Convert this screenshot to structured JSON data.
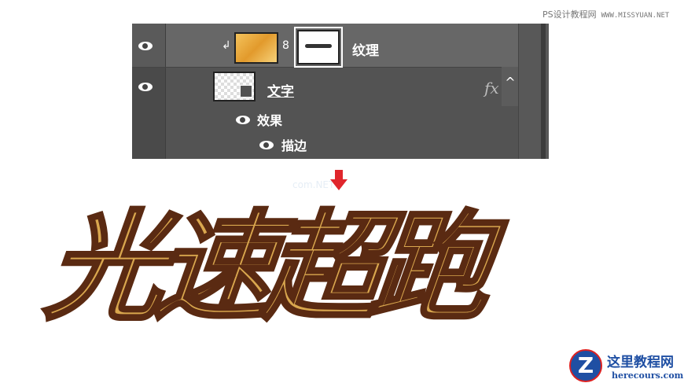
{
  "watermark": {
    "site": "PS设计教程网",
    "url": "WWW.MISSYUAN.NET"
  },
  "layers_panel": {
    "layers": [
      {
        "name": "纹理",
        "visible": true
      },
      {
        "name": "文字",
        "visible": true,
        "fx_label": "fx",
        "collapse_icon": "chevron-up-icon"
      }
    ],
    "effects": {
      "label": "效果",
      "items": [
        {
          "name": "描边"
        }
      ]
    }
  },
  "artwork": {
    "title_text": "光速超跑",
    "arrow_color": "#e0262c"
  },
  "logo": {
    "name": "这里教程网",
    "url": "herecours.com",
    "letter": "Z"
  },
  "overlay_watermark": "com.NET"
}
